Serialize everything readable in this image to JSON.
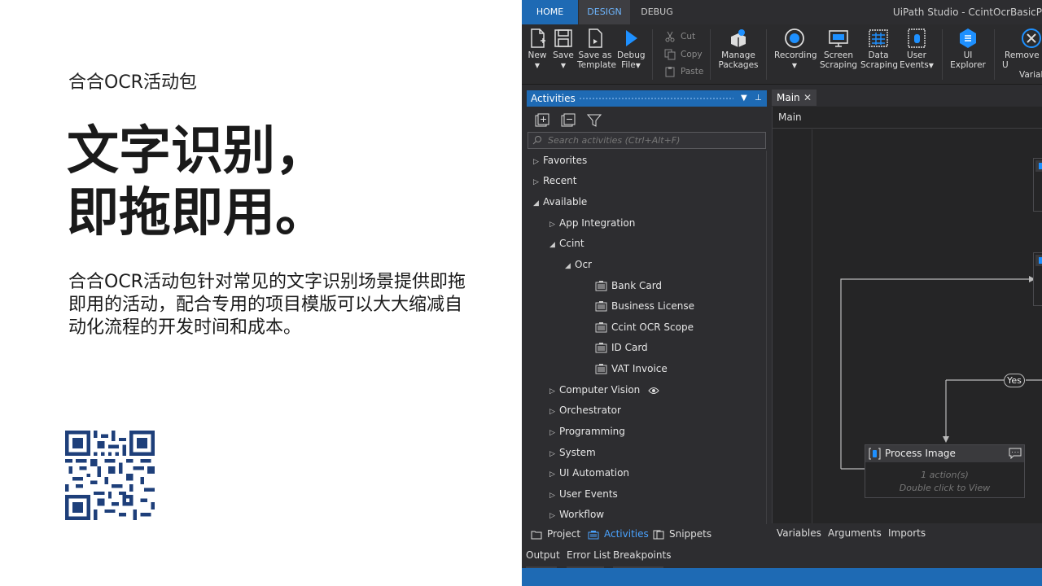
{
  "slide": {
    "subtitle": "合合OCR活动包",
    "headline_line1": "文字识别，",
    "headline_line2": "即拖即用。",
    "description": "合合OCR活动包针对常见的文字识别场景提供即拖即用的活动，配合专用的项目模版可以大大缩减自动化流程的开发时间和成本。"
  },
  "studio": {
    "window_title": "UiPath Studio - CcintOcrBasicP",
    "tabs": {
      "home": "HOME",
      "design": "DESIGN",
      "debug": "DEBUG"
    },
    "ribbon": {
      "new": "New",
      "save": "Save",
      "save_as_template_1": "Save as",
      "save_as_template_2": "Template",
      "debug_file_1": "Debug",
      "debug_file_2": "File",
      "cut": "Cut",
      "copy": "Copy",
      "paste": "Paste",
      "manage_packages_1": "Manage",
      "manage_packages_2": "Packages",
      "recording": "Recording",
      "screen_scraping_1": "Screen",
      "screen_scraping_2": "Scraping",
      "data_scraping_1": "Data",
      "data_scraping_2": "Scraping",
      "user_events_1": "User",
      "user_events_2": "Events",
      "ui_explorer_1": "UI",
      "ui_explorer_2": "Explorer",
      "remove_unused_1": "Remove U",
      "remove_unused_2": "Variabl"
    },
    "activities": {
      "title": "Activities",
      "search_placeholder": "Search activities (Ctrl+Alt+F)",
      "tree": {
        "favorites": "Favorites",
        "recent": "Recent",
        "available": "Available",
        "app_integration": "App Integration",
        "ccint": "Ccint",
        "ocr": "Ocr",
        "bank_card": "Bank Card",
        "business_license": "Business License",
        "ccint_ocr_scope": "Ccint OCR Scope",
        "id_card": "ID Card",
        "vat_invoice": "VAT Invoice",
        "computer_vision": "Computer Vision",
        "orchestrator": "Orchestrator",
        "programming": "Programming",
        "system": "System",
        "ui_automation": "UI Automation",
        "user_events": "User Events",
        "workflow": "Workflow"
      }
    },
    "panel_tabs": {
      "project": "Project",
      "activities": "Activities",
      "snippets": "Snippets"
    },
    "output_tabs": {
      "output": "Output",
      "error_list": "Error List",
      "breakpoints": "Breakpoints"
    },
    "designer": {
      "doc_tab": "Main",
      "breadcrumb": "Main",
      "yes_label": "Yes",
      "process_image": "Process Image",
      "process_line1": "1 action(s)",
      "process_line2": "Double click to View",
      "bottom": {
        "variables": "Variables",
        "arguments": "Arguments",
        "imports": "Imports"
      }
    }
  }
}
